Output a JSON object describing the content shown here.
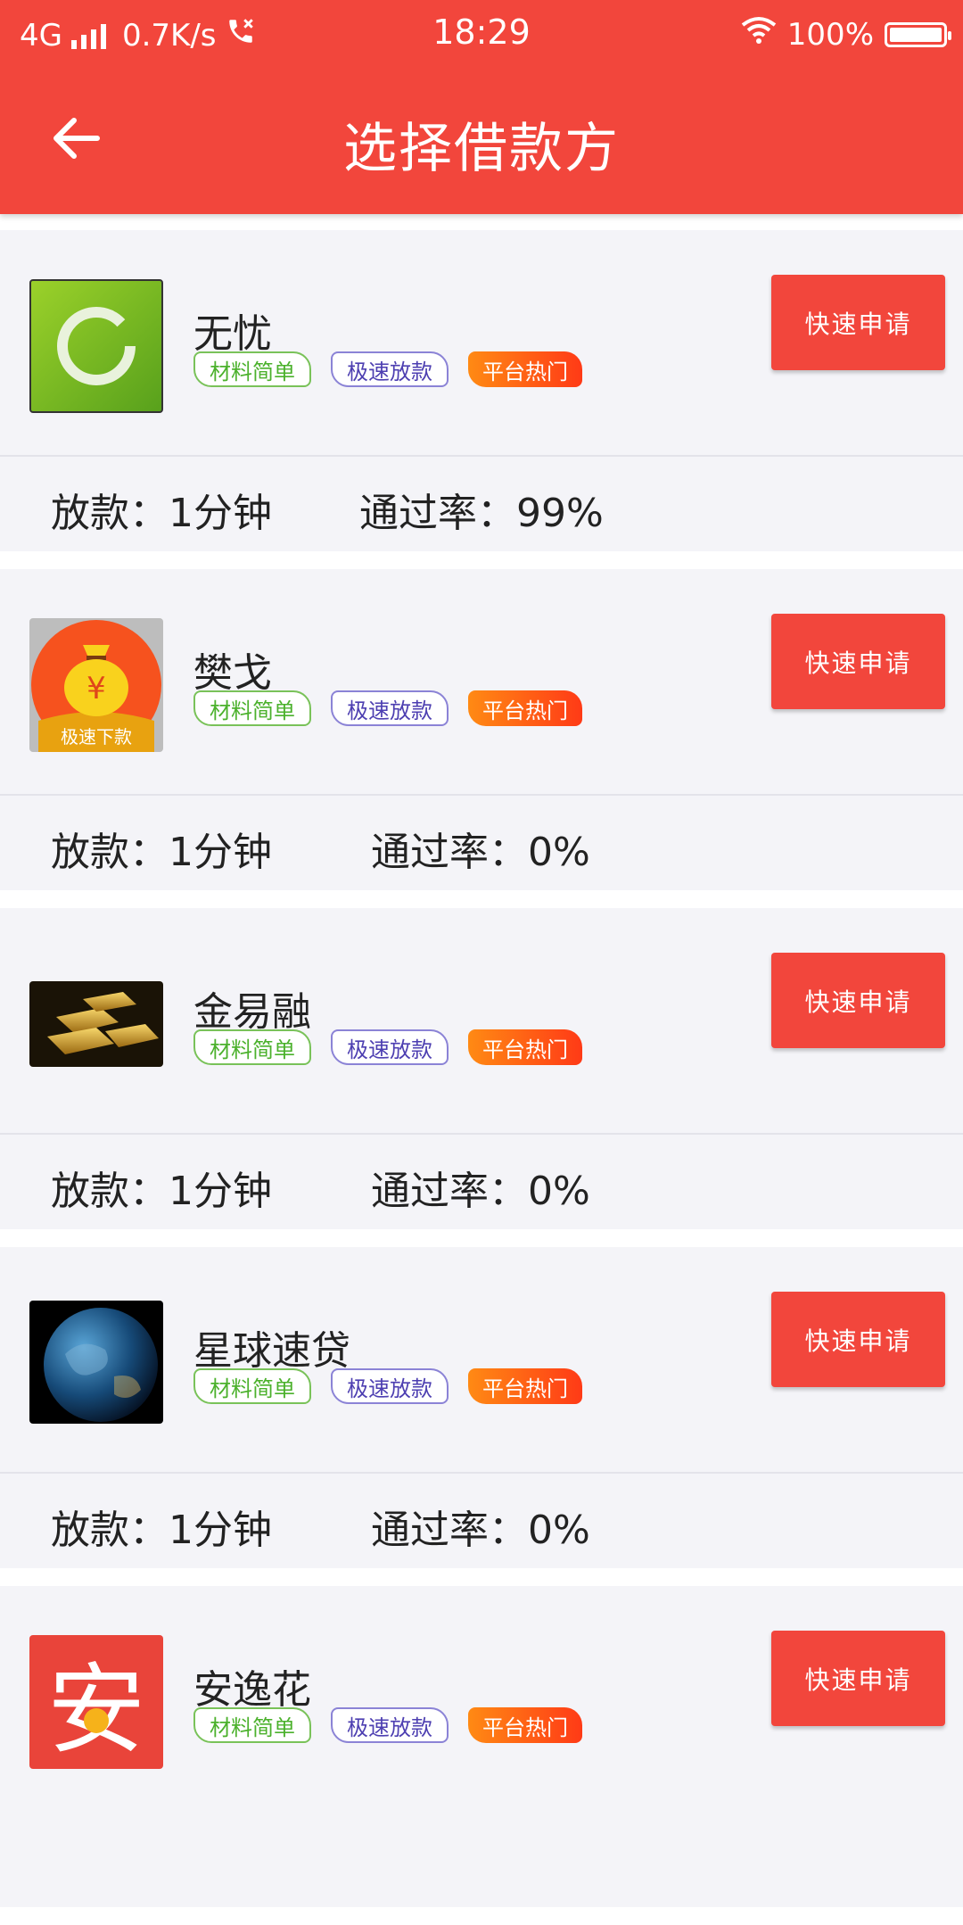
{
  "status_bar": {
    "network": "4G",
    "speed": "0.7K/s",
    "time": "18:29",
    "battery": "100%",
    "icons": [
      "signal-icon",
      "call-icon",
      "wifi-icon",
      "battery-icon"
    ]
  },
  "header": {
    "title": "选择借款方",
    "back_icon": "back-arrow-icon",
    "background": "#f2463c"
  },
  "tags": {
    "simple": "材料简单",
    "fast": "极速放款",
    "hot": "平台热门"
  },
  "apply_label": "快速申请",
  "items": [
    {
      "name": "无忧",
      "loan_label": "放款：",
      "loan_time": "1分钟",
      "rate_label": "通过率：",
      "rate": "99%",
      "logo_icon": "green-ring-logo-icon"
    },
    {
      "name": "樊戈",
      "loan_label": "放款：",
      "loan_time": "1分钟",
      "rate_label": "通过率：",
      "rate": "0%",
      "logo_icon": "money-bag-logo-icon",
      "logo_text": "极速下款"
    },
    {
      "name": "金易融",
      "loan_label": "放款：",
      "loan_time": "1分钟",
      "rate_label": "通过率：",
      "rate": "0%",
      "logo_icon": "gold-bars-logo-icon"
    },
    {
      "name": "星球速贷",
      "loan_label": "放款：",
      "loan_time": "1分钟",
      "rate_label": "通过率：",
      "rate": "0%",
      "logo_icon": "earth-logo-icon"
    },
    {
      "name": "安逸花",
      "logo_icon": "anyihua-logo-icon",
      "logo_text": "安"
    }
  ]
}
